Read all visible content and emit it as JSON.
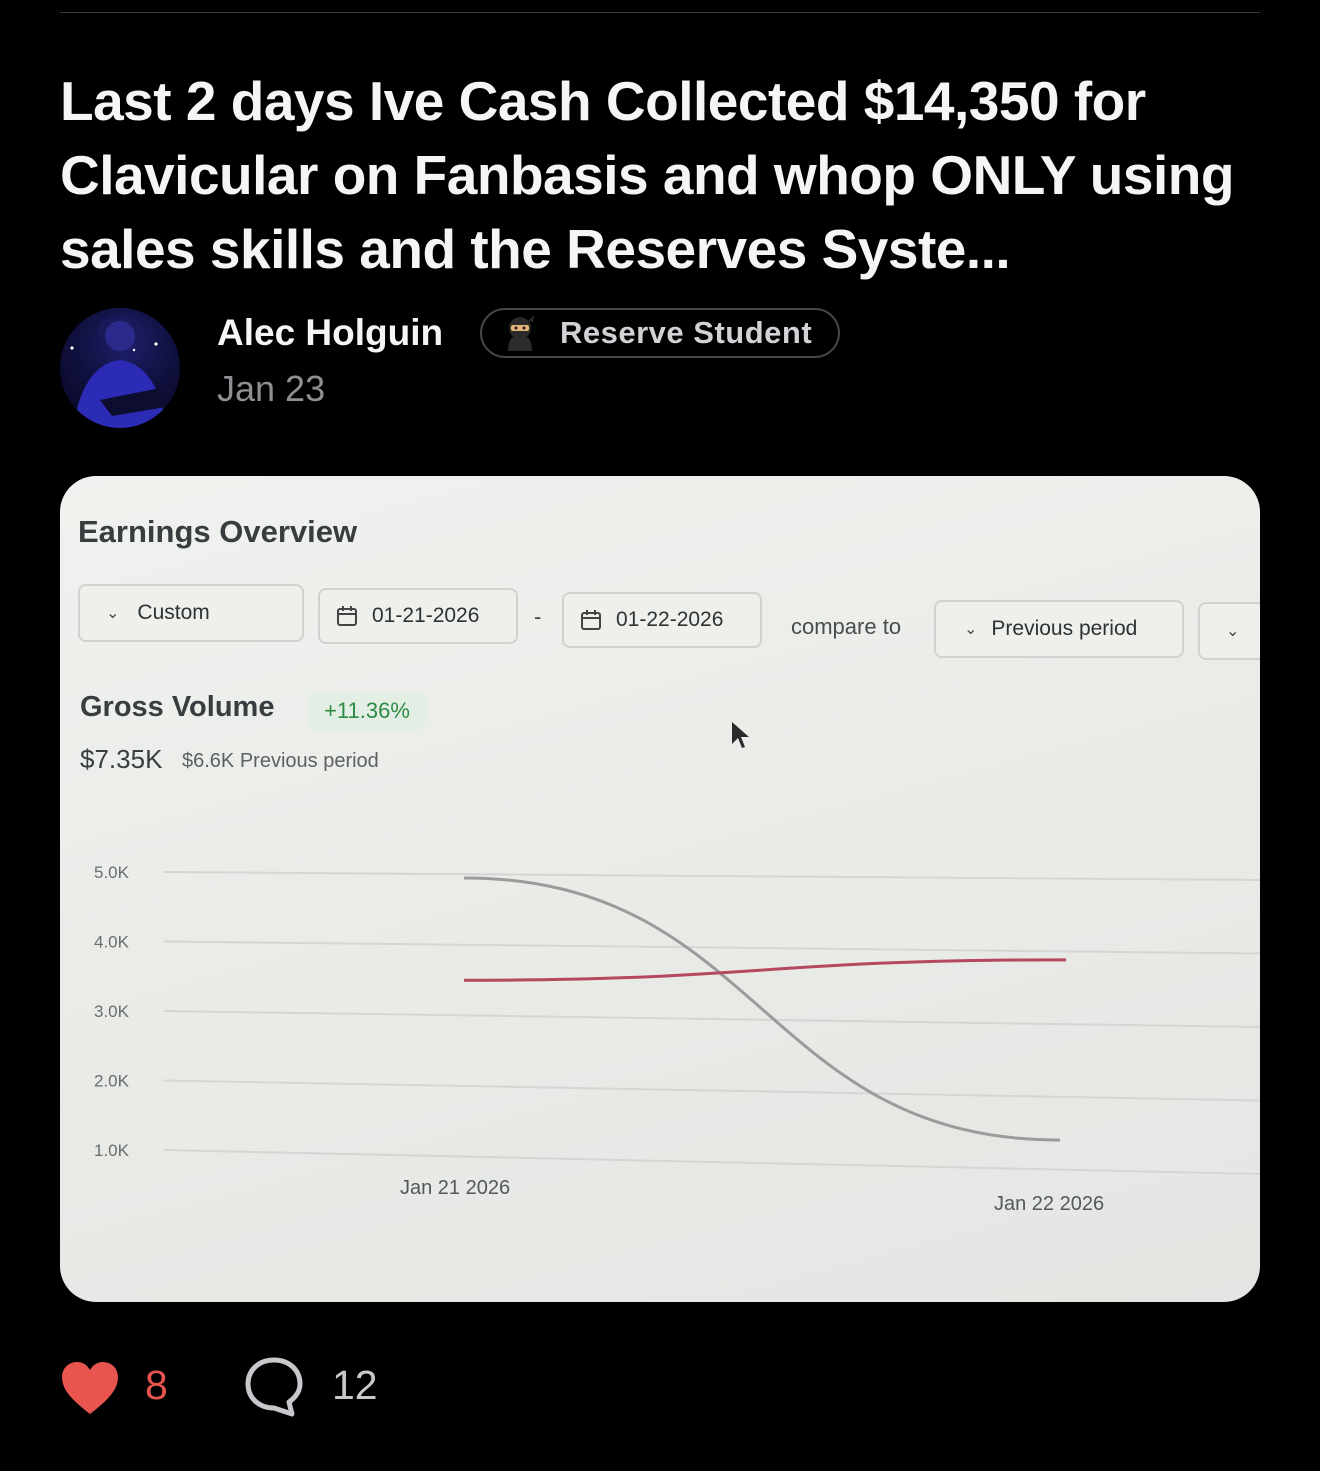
{
  "post": {
    "title": "Last 2 days Ive Cash Collected $14,350 for Clavicular on Fanbasis and whop ONLY using sales skills and the Reserves Syste...",
    "author": "Alec Holguin",
    "badge_label": "Reserve Student",
    "badge_icon": "ninja-emoji-icon",
    "date": "Jan 23",
    "likes": "8",
    "comments": "12",
    "accent_like_color": "#e8554e"
  },
  "screenshot": {
    "title": "Earnings Overview",
    "range_select": "Custom",
    "start_date": "01-21-2026",
    "separator": "-",
    "end_date": "01-22-2026",
    "compare_label": "compare to",
    "compare_select": "Previous period",
    "metric_label": "Gross Volume",
    "metric_change": "+11.36%",
    "metric_value": "$7.35K",
    "metric_previous": "$6.6K Previous period"
  },
  "chart_data": {
    "type": "line",
    "x": [
      "Jan 21 2026",
      "Jan 22 2026"
    ],
    "y_ticks": [
      "5.0K",
      "4.0K",
      "3.0K",
      "2.0K",
      "1.0K"
    ],
    "ylim": [
      1000,
      5000
    ],
    "grid": true,
    "series": [
      {
        "color": "#9a9c9c",
        "values": [
          5000,
          1200
        ]
      },
      {
        "color": "#b5485f",
        "values": [
          3500,
          3650
        ]
      }
    ]
  }
}
